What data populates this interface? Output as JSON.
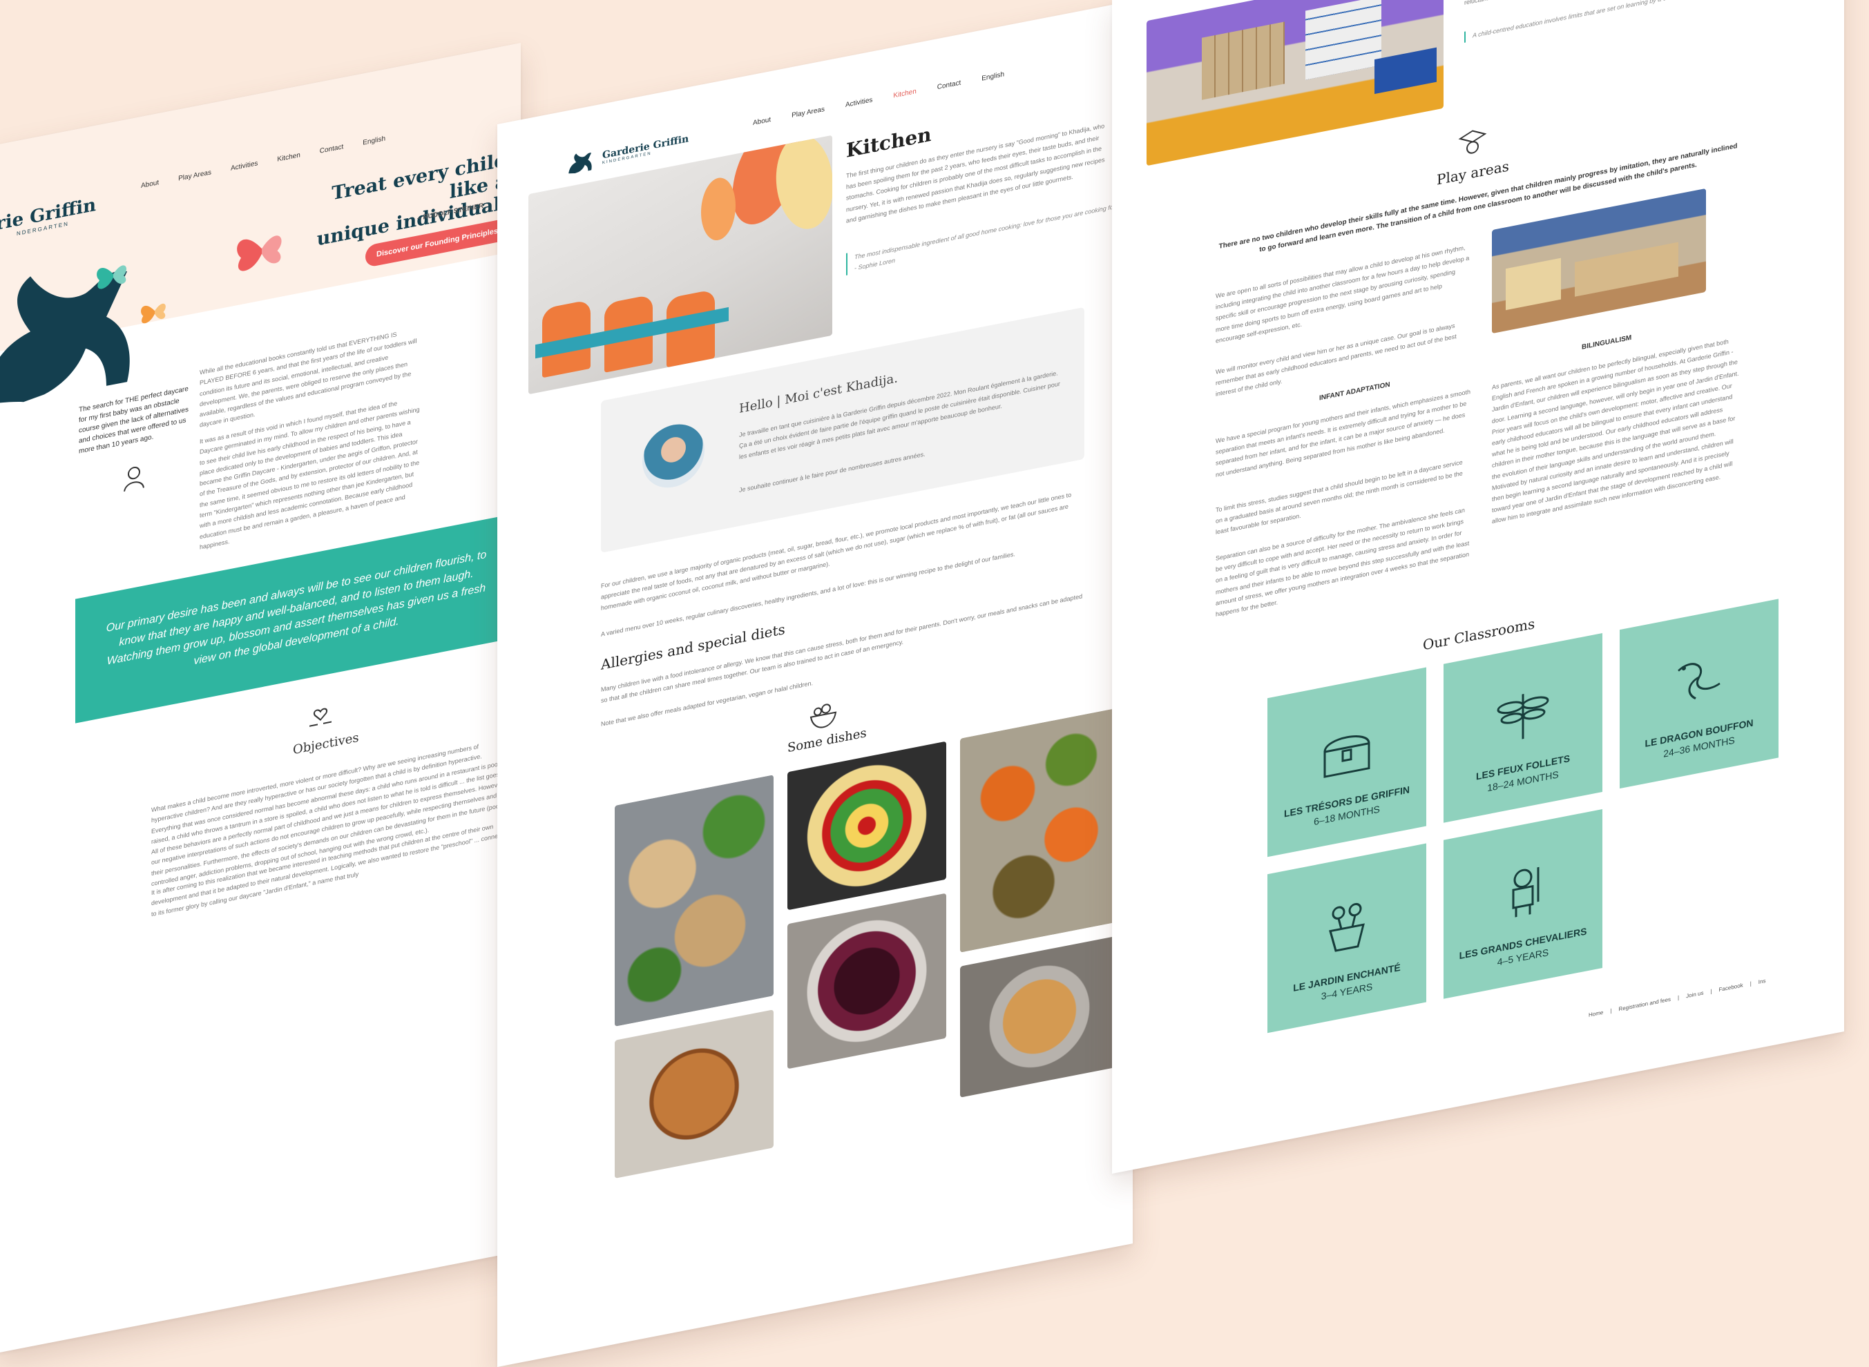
{
  "colors": {
    "background": "#fbe9dc",
    "teal": "#2fb5a0",
    "coral": "#ee5b5b",
    "tile": "#8fd1bd",
    "dark_teal": "#143f4f"
  },
  "left_page": {
    "brand_name": "rie Griffin",
    "brand_sub": "NDERGARTEN",
    "nav": [
      "About",
      "Play Areas",
      "Activities",
      "Kitchen",
      "Contact",
      "English"
    ],
    "hero_title_line1": "Treat every child like a",
    "hero_title_line2": "unique individual.",
    "hero_attribution": "– RUDOLF STEINER",
    "hero_button": "Discover our Founding Principles",
    "intro_side": "The search for THE perfect daycare for my first baby was an obstacle course given the lack of alternatives and choices that were offered to us more than 10 years ago.",
    "intro_para1": "While all the educational books constantly told us that EVERYTHING IS PLAYED BEFORE 6 years, and that the first years of the life of our toddlers will condition its future and its social, emotional, intellectual, and creative development. We, the parents, were obliged to reserve the only places then available, regardless of the values and educational program conveyed by the daycare in question.",
    "intro_para2": "It was as a result of this void in which I found myself, that the idea of the Daycare germinated in my mind. To allow my children and other parents wishing to see their child live his early childhood in the respect of his being, to have a place dedicated only to the development of babies and toddlers. This idea became the Griffin Daycare - Kindergarten, under the aegis of Griffon, protector of the Treasure of the Gods, and by extension, protector of our children. And, at the same time, it seemed obvious to me to restore its old letters of nobility to the term \"Kindergarten\" which represents nothing other than jee Kindergarten, but with a more childish and less academic connotation. Because early childhood education must be and remain a garden, a pleasure, a haven of peace and happiness.",
    "banner": "Our primary desire has been and always will be to see our children flourish, to know that they are happy and well-balanced, and to listen to them laugh. Watching them grow up, blossom and assert themselves has given us a fresh view on the global development of a child.",
    "objectives_title": "Objectives",
    "objectives_para1": "What makes a child become more introverted, more violent or more difficult? Why are we seeing increasing numbers of hyperactive children? And are they really hyperactive or has our society forgotten that a child is by definition hyperactive. Everything that was once considered normal has become abnormal these days: a child who runs around in a restaurant is poorly raised, a child who throws a tantrum in a store is spoiled, a child who does not listen to what he is told is difficult ... the list goes on. All of these behaviors are a perfectly normal part of childhood and we just a means for children to express themselves. However, our negative interpretations of such actions do not encourage children to grow up peacefully, while respecting themselves and their personalities. Furthermore, the effects of society's demands on our children can be devastating for them in the future (poorly controlled anger, addiction problems, dropping out of school, hanging out with the wrong crowd, etc.).",
    "objectives_para2": "It is after coming to this realization that we became interested in teaching methods that put children at the centre of their own development and that it be adapted to their natural development. Logically, we also wanted to restore the \"preschool\" ... connected to its former glory by calling our daycare \"Jardin d'Enfant,\" a name that truly"
  },
  "middle_page": {
    "brand_name": "Garderie Griffin",
    "brand_sub": "KINDERGARTEN",
    "nav": [
      "About",
      "Play Areas",
      "Activities",
      "Kitchen",
      "Contact",
      "English"
    ],
    "active_nav": "Kitchen",
    "title": "Kitchen",
    "intro": "The first thing our children do as they enter the nursery is say \"Good morning\" to Khadija, who has been spoiling them for the past 2 years, who feeds their eyes, their taste buds, and their stomachs. Cooking for children is probably one of the most difficult tasks to accomplish in the nursery. Yet, it is with renewed passion that Khadija does so, regularly suggesting new recipes and garnishing the dishes to make them pleasant in the eyes of our little gourmets.",
    "quote": "The most indispensable ingredient of all good home cooking: love for those you are cooking for. - Sophie Loren",
    "hello_title": "Hello | Moi c'est Khadija.",
    "hello_para1": "Je travaille en tant que cuisinière à la Garderie Griffin depuis décembre 2022. Mon Roulant également à la garderie. Ça a été un choix évident de faire partie de l'équipe griffin quand le poste de cuisinière était disponible. Cuisiner pour les enfants et les voir réagir à mes petits plats fait avec amour m'apporte beaucoup de bonheur.",
    "hello_para2": "Je souhaite continuer à le faire pour de nombreuses autres années.",
    "ingredients_para": "For our children, we use a large majority of organic products (meat, oil, sugar, bread, flour, etc.), we promote local products and most importantly, we teach our little ones to appreciate the real taste of foods, not any that are denatured by an excess of salt (which we do not use), sugar (which we replace % of with fruit), or fat (all our sauces are homemade with organic coconut oil, coconut milk, and without butter or margarine).",
    "menu_para": "A varied menu over 10 weeks, regular culinary discoveries, healthy ingredients, and a lot of love: this is our winning recipe to the delight of our families.",
    "allergies_title": "Allergies and special diets",
    "allergies_para": "Many children live with a food intolerance or allergy. We know that this can cause stress, both for them and for their parents. Don't worry, our meals and snacks can be adapted so that all the children can share meal times together. Our team is also trained to act in case of an emergency.",
    "allergies_note": "Note that we also offer meals adapted for vegetarian, vegan or halal children.",
    "dishes_title": "Some dishes"
  },
  "right_page": {
    "top_para": "Children are not all the same. Every child is unique, and with the support of our early childhood educators, we create a development. Every class contains children who will develop at their own pace. This is why we ... to a child's natural need for development. Every child is unique, and with the support of our early childhood educators, some children will develop more quickly, and others may be more reluctant to leave the uniqueness. Some may develop more quickly, and others may be more reluctant to leave the magical world of childhood behind ... so we will adapt to them.",
    "top_quote": "A child-centred education involves limits that are set on learning by a child's current stage of development. - Jean Piaget",
    "play_title": "Play areas",
    "play_intro": "There are no two children who develop their skills fully at the same time. However, given that children mainly progress by imitation, they are naturally inclined to go forward and learn even more. The transition of a child from one classroom to another will be discussed with the child's parents.",
    "play_para1": "We are open to all sorts of possibilities that may allow a child to develop at his own rhythm, including integrating the child into another classroom for a few hours a day to help develop a specific skill or encourage progression to the next stage by arousing curiosity, spending more time doing sports to burn off extra energy, using board games and art to help encourage self-expression, etc.",
    "play_para2": "We will monitor every child and view him or her as a unique case. Our goal is to always remember that as early childhood educators and parents, we need to act out of the best interest of the child only.",
    "adaptation_title": "INFANT ADAPTATION",
    "adaptation_para1": "We have a special program for young mothers and their infants, which emphasizes a smooth separation that meets an infant's needs. It is extremely difficult and trying for a mother to be separated from her infant, and for the infant, it can be a major source of anxiety — he does not understand anything. Being separated from his mother is like being abandoned.",
    "adaptation_para2": "To limit this stress, studies suggest that a child should begin to be left in a daycare service on a graduated basis at around seven months old; the ninth month is considered to be the least favourable for separation.",
    "adaptation_para3": "Separation can also be a source of difficulty for the mother. The ambivalence she feels can be very difficult to cope with and accept. Her need or the necessity to return to work brings on a feeling of guilt that is very difficult to manage, causing stress and anxiety. In order for mothers and their infants to be able to move beyond this step successfully and with the least amount of stress, we offer young mothers an integration over 4 weeks so that the separation happens for the better.",
    "bilingual_title": "BILINGUALISM",
    "bilingual_para": "As parents, we all want our children to be perfectly bilingual, especially given that both English and French are spoken in a growing number of households. At Garderie Griffin - Jardin d'Enfant, our children will experience bilingualism as soon as they step through the door. Learning a second language, however, will only begin in year one of Jardin d'Enfant. Prior years will focus on the child's own development: motor, affective and creative. Our early childhood educators will all be bilingual to ensure that every infant can understand what he is being told and be understood. Our early childhood educators will address children in their mother tongue, because this is the language that will serve as a base for the evolution of their language skills and understanding of the world around them. Motivated by natural curiosity and an innate desire to learn and understand, children will then begin learning a second language naturally and spontaneously. And it is precisely toward year one of Jardin d'Enfant that the stage of development reached by a child will allow him to integrate and assimilate such new information with disconcerting ease.",
    "classrooms_title": "Our Classrooms",
    "classrooms": [
      {
        "name": "LES TRÉSORS DE GRIFFIN",
        "age": "6–18 MONTHS",
        "icon": "treasure-chest-icon"
      },
      {
        "name": "LES FEUX FOLLETS",
        "age": "18–24 MONTHS",
        "icon": "dragonfly-icon"
      },
      {
        "name": "LE DRAGON BOUFFON",
        "age": "24–36 MONTHS",
        "icon": "dragon-icon"
      },
      {
        "name": "LE JARDIN ENCHANTÉ",
        "age": "3–4 YEARS",
        "icon": "flower-pot-icon"
      },
      {
        "name": "LES GRANDS CHEVALIERS",
        "age": "4–5 YEARS",
        "icon": "knight-icon"
      }
    ],
    "footer_links": [
      "Home",
      "Registration and fees",
      "Join us",
      "Facebook",
      "Ins"
    ]
  }
}
